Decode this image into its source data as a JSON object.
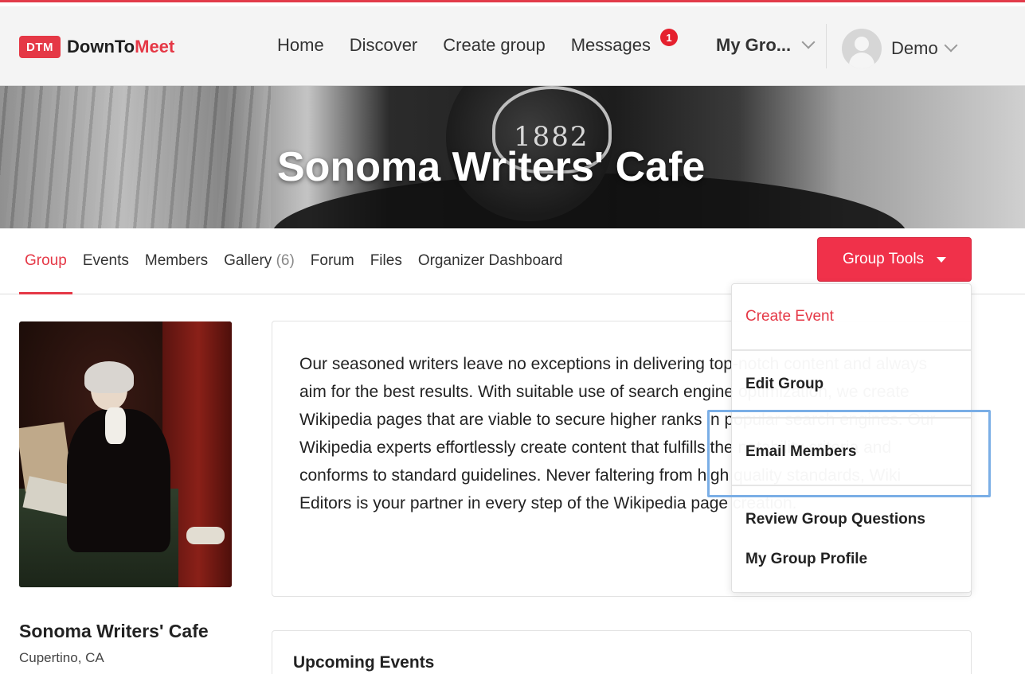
{
  "header": {
    "logo_badge": "DTM",
    "logo_text_part1": "DownTo",
    "logo_text_part2": "Meet",
    "nav": [
      "Home",
      "Discover",
      "Create group",
      "Messages"
    ],
    "messages_badge": "1",
    "my_groups": "My Gro...",
    "user_name": "Demo"
  },
  "banner": {
    "title": "Sonoma Writers' Cafe",
    "cup_number": "1882"
  },
  "tabs": {
    "items": [
      "Group",
      "Events",
      "Members",
      "Gallery",
      "Forum",
      "Files",
      "Organizer Dashboard"
    ],
    "gallery_count": "(6)",
    "active": "Group"
  },
  "group_tools": {
    "label": "Group Tools",
    "menu": [
      "Create Event",
      "Edit Group",
      "Email Members",
      "Review Group Questions",
      "My Group Profile"
    ]
  },
  "sidebar": {
    "group_name": "Sonoma Writers' Cafe",
    "location": "Cupertino, CA"
  },
  "description": {
    "text": "Our seasoned writers leave no exceptions in delivering top-notch content and always aim for the best results. With suitable use of search engine optimization, we create Wikipedia pages that are viable to secure higher ranks in popular search engines. Our Wikipedia experts effortlessly create content that fulfills the notability criteria and conforms to standard guidelines. Never faltering from high quality standards, Wiki Editors is your partner in every step of the Wikipedia page creation."
  },
  "events": {
    "title": "Upcoming Events"
  },
  "colors": {
    "brand_red": "#e53846",
    "highlight_blue": "#7aaee6"
  }
}
